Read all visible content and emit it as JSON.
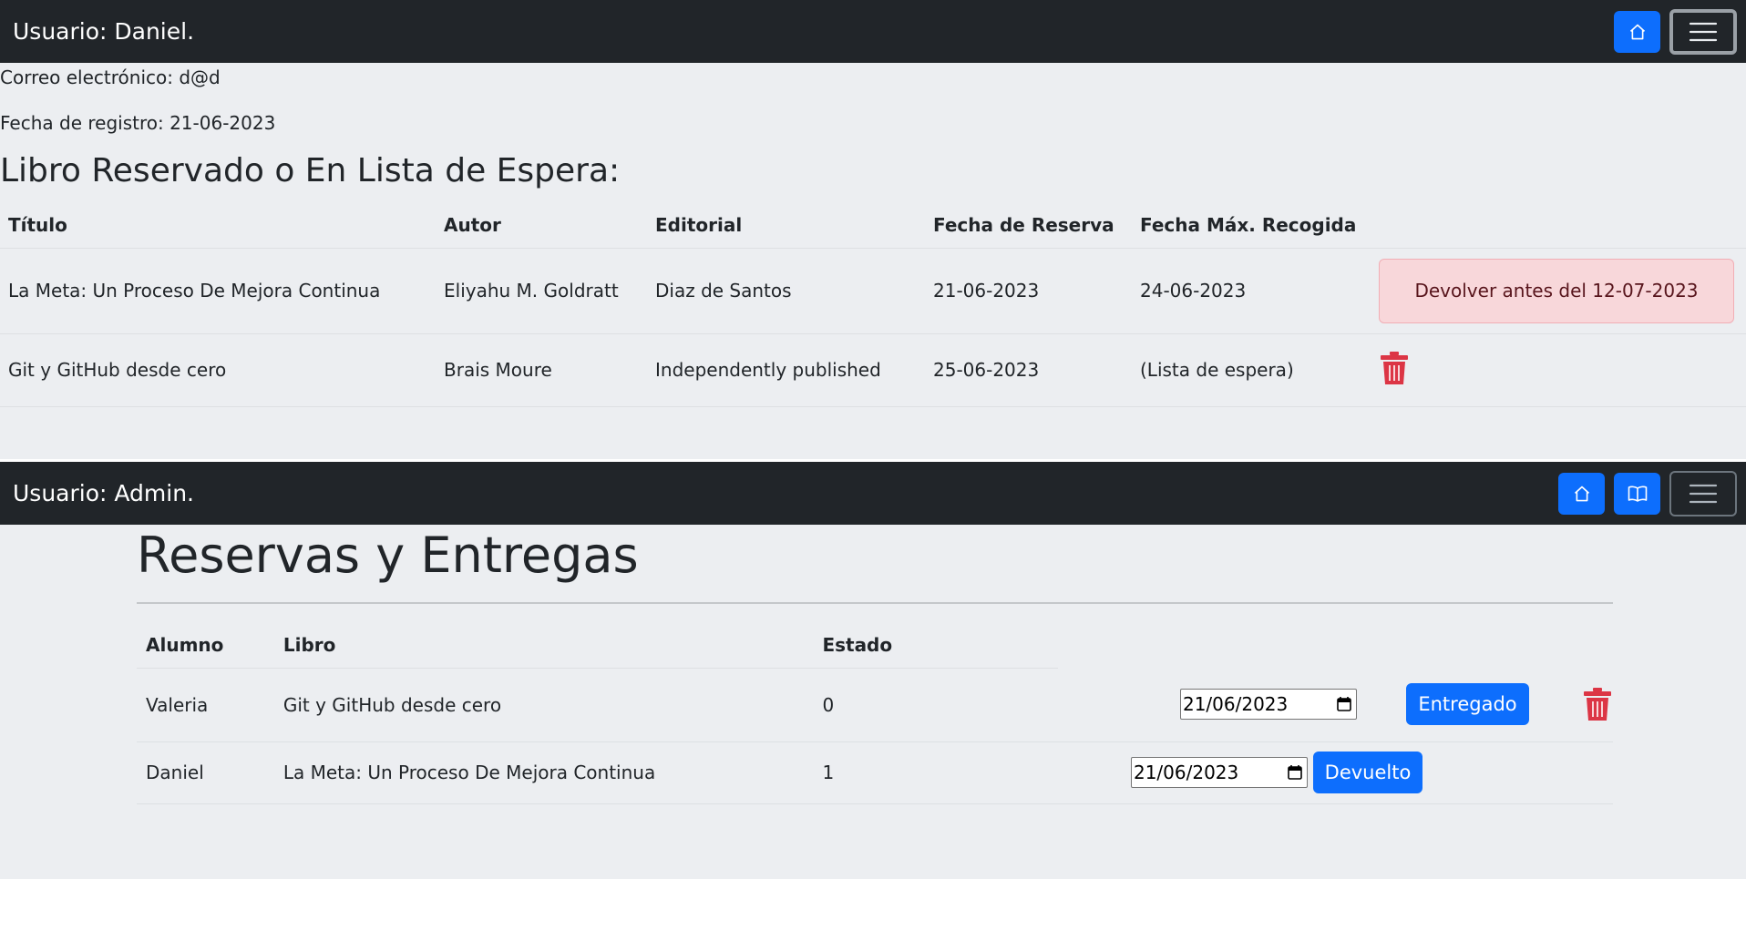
{
  "user_view": {
    "navbar": {
      "brand": "Usuario: Daniel."
    },
    "email_line": "Correo electrónico: d@d",
    "register_line": "Fecha de registro: 21-06-2023",
    "section_title": "Libro Reservado o En Lista de Espera:",
    "table": {
      "headers": [
        "Título",
        "Autor",
        "Editorial",
        "Fecha de Reserva",
        "Fecha Máx. Recogida"
      ],
      "rows": [
        {
          "titulo": "La Meta: Un Proceso De Mejora Continua",
          "autor": "Eliyahu M. Goldratt",
          "editorial": "Diaz de Santos",
          "fecha_reserva": "21-06-2023",
          "fecha_max": "24-06-2023",
          "alert": "Devolver antes del 12-07-2023"
        },
        {
          "titulo": "Git y GitHub desde cero",
          "autor": "Brais Moure",
          "editorial": "Independently published",
          "fecha_reserva": "25-06-2023",
          "fecha_max": "(Lista de espera)"
        }
      ]
    }
  },
  "admin_view": {
    "navbar": {
      "brand": "Usuario: Admin."
    },
    "heading": "Reservas y Entregas",
    "table": {
      "headers": [
        "Alumno",
        "Libro",
        "Estado"
      ],
      "rows": [
        {
          "alumno": "Valeria",
          "libro": "Git y GitHub desde cero",
          "estado": "0",
          "date": "21/06/2023",
          "button": "Entregado"
        },
        {
          "alumno": "Daniel",
          "libro": "La Meta: Un Proceso De Mejora Continua",
          "estado": "1",
          "date": "21/06/2023",
          "button": "Devuelto"
        }
      ]
    }
  },
  "colors": {
    "navbar": "#212529",
    "primary": "#0d6efd",
    "danger": "#dc3545",
    "panel": "#eceef1"
  },
  "icons": [
    "house-icon",
    "hamburger-menu-icon",
    "book-icon",
    "trash-icon",
    "calendar-icon"
  ]
}
